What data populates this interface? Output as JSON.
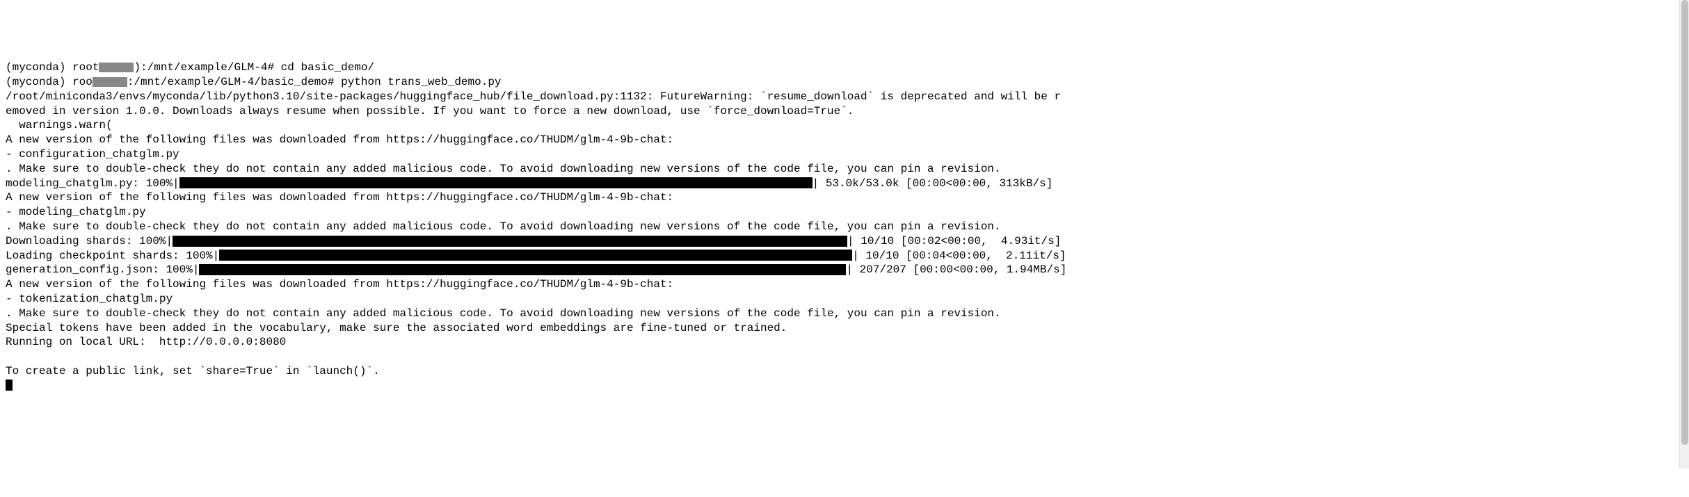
{
  "prompt1": {
    "env": "(myconda)",
    "user_host": " root",
    "path": "):/mnt/example/GLM-4#",
    "cmd": " cd basic_demo/"
  },
  "prompt2": {
    "env": "(myconda)",
    "user_host": " roo",
    "path": ":/mnt/example/GLM-4/basic_demo#",
    "cmd": " python trans_web_demo.py"
  },
  "lines": {
    "warn1": "/root/miniconda3/envs/myconda/lib/python3.10/site-packages/huggingface_hub/file_download.py:1132: FutureWarning: `resume_download` is deprecated and will be r",
    "warn2": "emoved in version 1.0.0. Downloads always resume when possible. If you want to force a new download, use `force_download=True`.",
    "warn3": "  warnings.warn(",
    "newver1": "A new version of the following files was downloaded from https://huggingface.co/THUDM/glm-4-9b-chat:",
    "file1": "- configuration_chatglm.py",
    "malicious1": ". Make sure to double-check they do not contain any added malicious code. To avoid downloading new versions of the code file, you can pin a revision.",
    "prog1_label": "modeling_chatglm.py: 100%|",
    "prog1_stats": "| 53.0k/53.0k [00:00<00:00, 313kB/s]",
    "newver2": "A new version of the following files was downloaded from https://huggingface.co/THUDM/glm-4-9b-chat:",
    "file2": "- modeling_chatglm.py",
    "malicious2": ". Make sure to double-check they do not contain any added malicious code. To avoid downloading new versions of the code file, you can pin a revision.",
    "prog2_label": "Downloading shards: 100%|",
    "prog2_stats": "| 10/10 [00:02<00:00,  4.93it/s]",
    "prog3_label": "Loading checkpoint shards: 100%|",
    "prog3_stats": "| 10/10 [00:04<00:00,  2.11it/s]",
    "prog4_label": "generation_config.json: 100%|",
    "prog4_stats": "| 207/207 [00:00<00:00, 1.94MB/s]",
    "newver3": "A new version of the following files was downloaded from https://huggingface.co/THUDM/glm-4-9b-chat:",
    "file3": "- tokenization_chatglm.py",
    "malicious3": ". Make sure to double-check they do not contain any added malicious code. To avoid downloading new versions of the code file, you can pin a revision.",
    "special_tokens": "Special tokens have been added in the vocabulary, make sure the associated word embeddings are fine-tuned or trained.",
    "running": "Running on local URL:  http://0.0.0.0:8080",
    "blank": "",
    "public_link": "To create a public link, set `share=True` in `launch()`."
  }
}
